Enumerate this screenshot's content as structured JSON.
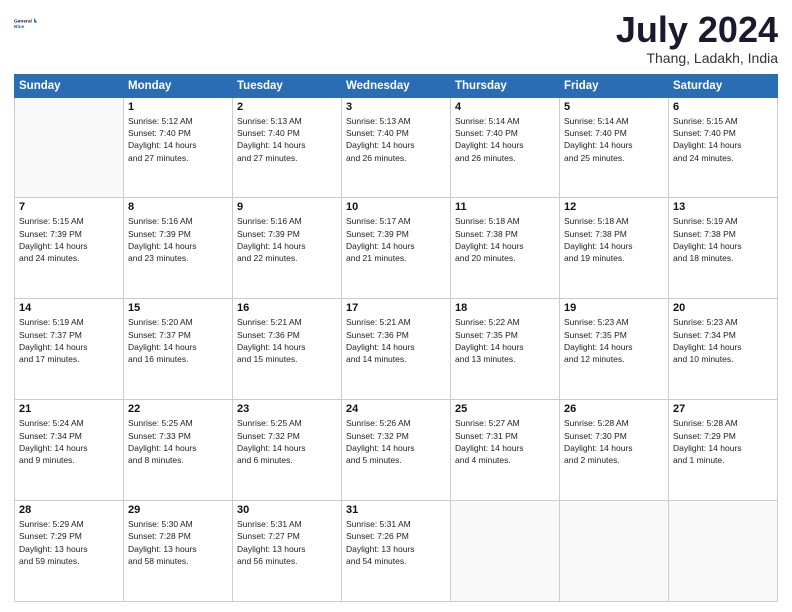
{
  "header": {
    "logo_line1": "General",
    "logo_line2": "Blue",
    "month_title": "July 2024",
    "location": "Thang, Ladakh, India"
  },
  "weekdays": [
    "Sunday",
    "Monday",
    "Tuesday",
    "Wednesday",
    "Thursday",
    "Friday",
    "Saturday"
  ],
  "weeks": [
    [
      {
        "day": "",
        "info": ""
      },
      {
        "day": "1",
        "info": "Sunrise: 5:12 AM\nSunset: 7:40 PM\nDaylight: 14 hours\nand 27 minutes."
      },
      {
        "day": "2",
        "info": "Sunrise: 5:13 AM\nSunset: 7:40 PM\nDaylight: 14 hours\nand 27 minutes."
      },
      {
        "day": "3",
        "info": "Sunrise: 5:13 AM\nSunset: 7:40 PM\nDaylight: 14 hours\nand 26 minutes."
      },
      {
        "day": "4",
        "info": "Sunrise: 5:14 AM\nSunset: 7:40 PM\nDaylight: 14 hours\nand 26 minutes."
      },
      {
        "day": "5",
        "info": "Sunrise: 5:14 AM\nSunset: 7:40 PM\nDaylight: 14 hours\nand 25 minutes."
      },
      {
        "day": "6",
        "info": "Sunrise: 5:15 AM\nSunset: 7:40 PM\nDaylight: 14 hours\nand 24 minutes."
      }
    ],
    [
      {
        "day": "7",
        "info": "Sunrise: 5:15 AM\nSunset: 7:39 PM\nDaylight: 14 hours\nand 24 minutes."
      },
      {
        "day": "8",
        "info": "Sunrise: 5:16 AM\nSunset: 7:39 PM\nDaylight: 14 hours\nand 23 minutes."
      },
      {
        "day": "9",
        "info": "Sunrise: 5:16 AM\nSunset: 7:39 PM\nDaylight: 14 hours\nand 22 minutes."
      },
      {
        "day": "10",
        "info": "Sunrise: 5:17 AM\nSunset: 7:39 PM\nDaylight: 14 hours\nand 21 minutes."
      },
      {
        "day": "11",
        "info": "Sunrise: 5:18 AM\nSunset: 7:38 PM\nDaylight: 14 hours\nand 20 minutes."
      },
      {
        "day": "12",
        "info": "Sunrise: 5:18 AM\nSunset: 7:38 PM\nDaylight: 14 hours\nand 19 minutes."
      },
      {
        "day": "13",
        "info": "Sunrise: 5:19 AM\nSunset: 7:38 PM\nDaylight: 14 hours\nand 18 minutes."
      }
    ],
    [
      {
        "day": "14",
        "info": "Sunrise: 5:19 AM\nSunset: 7:37 PM\nDaylight: 14 hours\nand 17 minutes."
      },
      {
        "day": "15",
        "info": "Sunrise: 5:20 AM\nSunset: 7:37 PM\nDaylight: 14 hours\nand 16 minutes."
      },
      {
        "day": "16",
        "info": "Sunrise: 5:21 AM\nSunset: 7:36 PM\nDaylight: 14 hours\nand 15 minutes."
      },
      {
        "day": "17",
        "info": "Sunrise: 5:21 AM\nSunset: 7:36 PM\nDaylight: 14 hours\nand 14 minutes."
      },
      {
        "day": "18",
        "info": "Sunrise: 5:22 AM\nSunset: 7:35 PM\nDaylight: 14 hours\nand 13 minutes."
      },
      {
        "day": "19",
        "info": "Sunrise: 5:23 AM\nSunset: 7:35 PM\nDaylight: 14 hours\nand 12 minutes."
      },
      {
        "day": "20",
        "info": "Sunrise: 5:23 AM\nSunset: 7:34 PM\nDaylight: 14 hours\nand 10 minutes."
      }
    ],
    [
      {
        "day": "21",
        "info": "Sunrise: 5:24 AM\nSunset: 7:34 PM\nDaylight: 14 hours\nand 9 minutes."
      },
      {
        "day": "22",
        "info": "Sunrise: 5:25 AM\nSunset: 7:33 PM\nDaylight: 14 hours\nand 8 minutes."
      },
      {
        "day": "23",
        "info": "Sunrise: 5:25 AM\nSunset: 7:32 PM\nDaylight: 14 hours\nand 6 minutes."
      },
      {
        "day": "24",
        "info": "Sunrise: 5:26 AM\nSunset: 7:32 PM\nDaylight: 14 hours\nand 5 minutes."
      },
      {
        "day": "25",
        "info": "Sunrise: 5:27 AM\nSunset: 7:31 PM\nDaylight: 14 hours\nand 4 minutes."
      },
      {
        "day": "26",
        "info": "Sunrise: 5:28 AM\nSunset: 7:30 PM\nDaylight: 14 hours\nand 2 minutes."
      },
      {
        "day": "27",
        "info": "Sunrise: 5:28 AM\nSunset: 7:29 PM\nDaylight: 14 hours\nand 1 minute."
      }
    ],
    [
      {
        "day": "28",
        "info": "Sunrise: 5:29 AM\nSunset: 7:29 PM\nDaylight: 13 hours\nand 59 minutes."
      },
      {
        "day": "29",
        "info": "Sunrise: 5:30 AM\nSunset: 7:28 PM\nDaylight: 13 hours\nand 58 minutes."
      },
      {
        "day": "30",
        "info": "Sunrise: 5:31 AM\nSunset: 7:27 PM\nDaylight: 13 hours\nand 56 minutes."
      },
      {
        "day": "31",
        "info": "Sunrise: 5:31 AM\nSunset: 7:26 PM\nDaylight: 13 hours\nand 54 minutes."
      },
      {
        "day": "",
        "info": ""
      },
      {
        "day": "",
        "info": ""
      },
      {
        "day": "",
        "info": ""
      }
    ]
  ]
}
